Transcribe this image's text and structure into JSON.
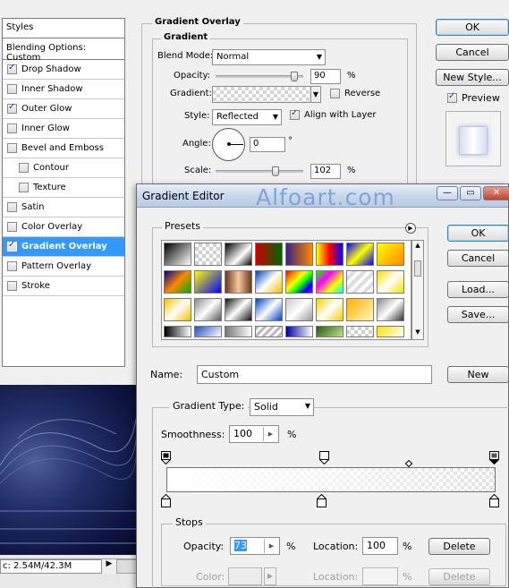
{
  "layer_style": {
    "styles_header": "Styles",
    "blending_options": "Blending Options: Custom",
    "items": [
      {
        "label": "Drop Shadow",
        "checked": true,
        "indent": false,
        "active": false
      },
      {
        "label": "Inner Shadow",
        "checked": false,
        "indent": false,
        "active": false
      },
      {
        "label": "Outer Glow",
        "checked": true,
        "indent": false,
        "active": false
      },
      {
        "label": "Inner Glow",
        "checked": false,
        "indent": false,
        "active": false
      },
      {
        "label": "Bevel and Emboss",
        "checked": false,
        "indent": false,
        "active": false
      },
      {
        "label": "Contour",
        "checked": false,
        "indent": true,
        "active": false
      },
      {
        "label": "Texture",
        "checked": false,
        "indent": true,
        "active": false
      },
      {
        "label": "Satin",
        "checked": false,
        "indent": false,
        "active": false
      },
      {
        "label": "Color Overlay",
        "checked": false,
        "indent": false,
        "active": false
      },
      {
        "label": "Gradient Overlay",
        "checked": true,
        "indent": false,
        "active": true
      },
      {
        "label": "Pattern Overlay",
        "checked": false,
        "indent": false,
        "active": false
      },
      {
        "label": "Stroke",
        "checked": false,
        "indent": false,
        "active": false
      }
    ],
    "section_title": "Gradient Overlay",
    "subsection_title": "Gradient",
    "blend_mode_label": "Blend Mode:",
    "blend_mode_value": "Normal",
    "opacity_label": "Opacity:",
    "opacity_value": "90",
    "opacity_fraction": 0.9,
    "percent": "%",
    "gradient_label": "Gradient:",
    "reverse_label": "Reverse",
    "style_label": "Style:",
    "style_value": "Reflected",
    "align_label": "Align with Layer",
    "angle_label": "Angle:",
    "angle_value": "0",
    "degree": "°",
    "scale_label": "Scale:",
    "scale_value": "102",
    "scale_fraction": 0.68,
    "ok_label": "OK",
    "cancel_label": "Cancel",
    "new_style_label": "New Style...",
    "preview_label": "Preview"
  },
  "status": {
    "doc_info": "c: 2.54M/42.3M"
  },
  "gradient_editor": {
    "title": "Gradient Editor",
    "watermark": "Alfoart.com",
    "presets_label": "Presets",
    "ok_label": "OK",
    "cancel_label": "Cancel",
    "load_label": "Load...",
    "save_label": "Save...",
    "name_label": "Name:",
    "name_value": "Custom",
    "new_label": "New",
    "gradient_type_label": "Gradient Type:",
    "gradient_type_value": "Solid",
    "smoothness_label": "Smoothness:",
    "smoothness_value": "100",
    "percent": "%",
    "stops_label": "Stops",
    "stop_opacity_label": "Opacity:",
    "stop_opacity_value": "73",
    "location_label": "Location:",
    "location_value": "100",
    "delete_label": "Delete",
    "color_label": "Color:",
    "color_location_label": "Location:",
    "color_delete_label": "Delete"
  },
  "colors": {
    "selection": "#3399ff",
    "watermark": "#7fa4d8"
  }
}
